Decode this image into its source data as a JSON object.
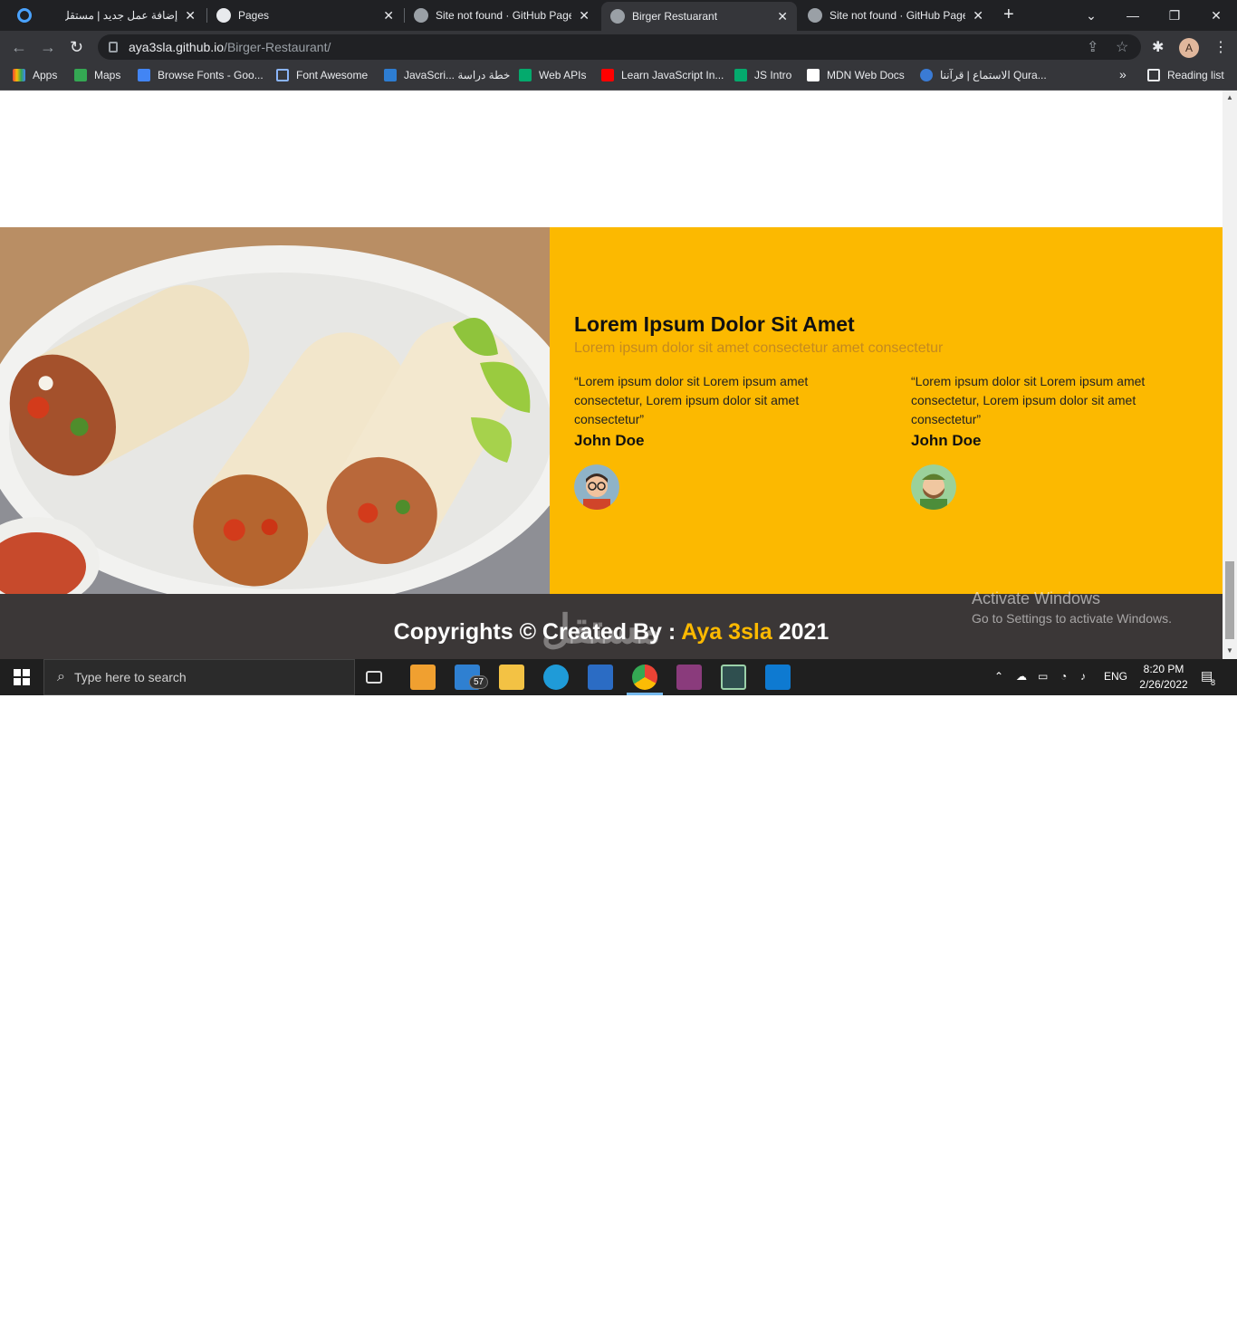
{
  "browser": {
    "tabs": [
      {
        "label": "إضافة عمل جديد | مستقل",
        "active": false
      },
      {
        "label": "Pages",
        "active": false
      },
      {
        "label": "Site not found · GitHub Pages",
        "active": false
      },
      {
        "label": "Birger Restuarant",
        "active": true
      },
      {
        "label": "Site not found · GitHub Pages",
        "active": false
      }
    ],
    "url_host": "aya3sla.github.io",
    "url_path": "/Birger-Restaurant/",
    "profile_initial": "A",
    "bookmarks": [
      {
        "label": "Apps"
      },
      {
        "label": "Maps"
      },
      {
        "label": "Browse Fonts - Goo..."
      },
      {
        "label": "Font Awesome"
      },
      {
        "label": "JavaScri... خطة دراسة"
      },
      {
        "label": "Web APIs"
      },
      {
        "label": "Learn JavaScript In..."
      },
      {
        "label": "JS Intro"
      },
      {
        "label": "MDN Web Docs"
      },
      {
        "label": "الاستماع | قرآننا Qura..."
      }
    ],
    "bookmarks_more": "»",
    "reading_list": "Reading list"
  },
  "testimonials": {
    "title": "Lorem Ipsum Dolor Sit Amet",
    "subtitle": "Lorem ipsum dolor sit amet consectetur amet consectetur",
    "items": [
      {
        "quote": "“Lorem ipsum dolor sit Lorem ipsum amet consectetur, Lorem ipsum dolor sit amet consectetur”",
        "name": "John Doe"
      },
      {
        "quote": "“Lorem ipsum dolor sit Lorem ipsum amet consectetur, Lorem ipsum dolor sit amet consectetur”",
        "name": "John Doe"
      }
    ]
  },
  "footer": {
    "prefix": "Copyrights © Created By : ",
    "author": "Aya 3sla",
    "year": " 2021"
  },
  "overlay": {
    "activate_title": "Activate Windows",
    "activate_sub": "Go to Settings to activate Windows.",
    "watermark": "مستقل",
    "watermark_url": "mostaql.com"
  },
  "taskbar": {
    "search_placeholder": "Type here to search",
    "mail_badge": "57",
    "lang": "ENG",
    "time": "8:20 PM",
    "date": "2/26/2022",
    "notif_count": "8"
  },
  "colors": {
    "accent": "#fcb900",
    "footer_bg": "#3b3737"
  }
}
